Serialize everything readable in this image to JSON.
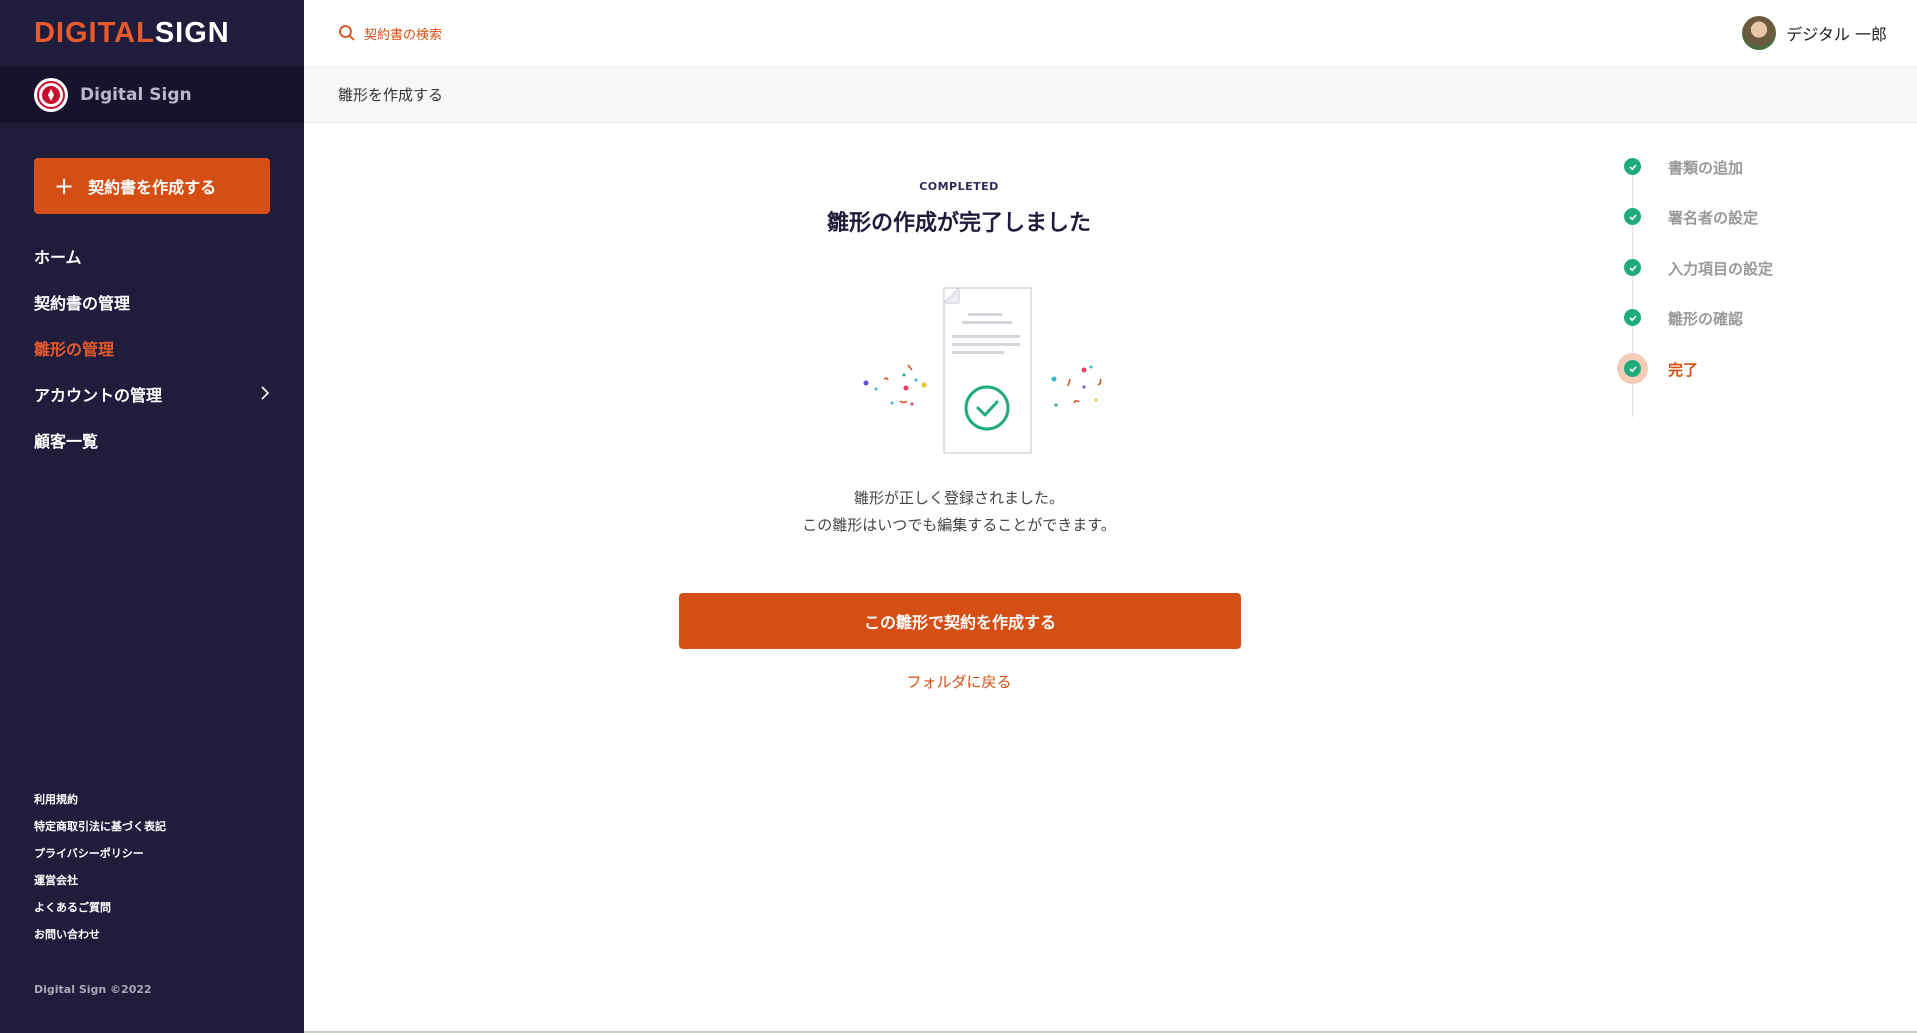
{
  "brand": {
    "part1": "DIGITAL",
    "part2": "SIGN"
  },
  "org": {
    "name": "Digital Sign"
  },
  "sidebar": {
    "create_button": "契約書を作成する",
    "items": [
      {
        "label": "ホーム"
      },
      {
        "label": "契約書の管理"
      },
      {
        "label": "雛形の管理"
      },
      {
        "label": "アカウントの管理"
      },
      {
        "label": "顧客一覧"
      }
    ],
    "footer_links": [
      {
        "label": "利用規約"
      },
      {
        "label": "特定商取引法に基づく表記"
      },
      {
        "label": "プライバシーポリシー"
      },
      {
        "label": "運営会社"
      },
      {
        "label": "よくあるご質問"
      },
      {
        "label": "お問い合わせ"
      }
    ],
    "copyright": "Digital Sign ©2022"
  },
  "header": {
    "search_placeholder": "契約書の検索",
    "user_name": "デジタル 一郎"
  },
  "breadcrumb": "雛形を作成する",
  "main": {
    "status_label": "COMPLETED",
    "title": "雛形の作成が完了しました",
    "message_line1": "雛形が正しく登録されました。",
    "message_line2": "この雛形はいつでも編集することができます。",
    "primary_button": "この雛形で契約を作成する",
    "back_link": "フォルダに戻る"
  },
  "steps": [
    {
      "label": "書類の追加",
      "state": "done"
    },
    {
      "label": "署名者の設定",
      "state": "done"
    },
    {
      "label": "入力項目の設定",
      "state": "done"
    },
    {
      "label": "雛形の確認",
      "state": "done"
    },
    {
      "label": "完了",
      "state": "current"
    }
  ],
  "colors": {
    "accent": "#d54f15",
    "sidebar_bg": "#1f1c3c",
    "success": "#1fab7c"
  },
  "icons": {
    "search": "search-icon",
    "plus": "plus-icon",
    "chevron": "chevron-right-icon",
    "check": "check-icon"
  }
}
